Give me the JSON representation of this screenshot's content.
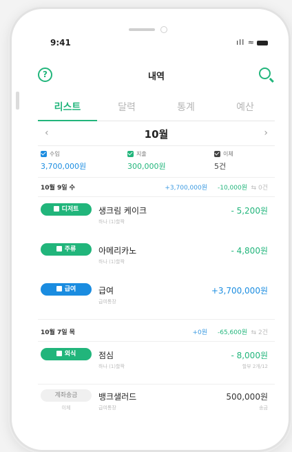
{
  "status": {
    "time": "9:41",
    "icons": "ıll ≈"
  },
  "header": {
    "title": "내역"
  },
  "tabs": [
    {
      "label": "리스트",
      "active": true
    },
    {
      "label": "달력"
    },
    {
      "label": "통계"
    },
    {
      "label": "예산"
    }
  ],
  "month": {
    "label": "10월",
    "prev": "‹",
    "next": "›"
  },
  "summary": {
    "income": {
      "label": "수입",
      "value": "3,700,000원",
      "color": "#1a8ce0"
    },
    "expense": {
      "label": "지출",
      "value": "300,000원",
      "color": "#21b57b"
    },
    "transfer": {
      "label": "이체",
      "value": "5건",
      "color": "#444444"
    }
  },
  "groups": [
    {
      "date": "10월 9일 수",
      "income": "+3,700,000원",
      "expense": "-10,000원",
      "count": "⇆ 0건",
      "items": [
        {
          "category": "디저트",
          "name": "생크림 케이크",
          "sub": "하나 (1)할짝",
          "amount": "- 5,200원",
          "color": "green"
        },
        {
          "category": "주류",
          "name": "아메리카노",
          "sub": "하나 (1)할짝",
          "amount": "- 4,800원",
          "color": "green"
        },
        {
          "category": "급여",
          "name": "급여",
          "sub": "급여통장",
          "amount": "+3,700,000원",
          "color": "blue"
        }
      ]
    },
    {
      "date": "10월 7일 목",
      "income": "+0원",
      "expense": "-65,600원",
      "count": "⇆ 2건",
      "items": [
        {
          "category": "외식",
          "name": "점심",
          "sub": "하나 (1)할짝",
          "amount": "- 8,000원",
          "asub": "할부 2개/12",
          "color": "green"
        },
        {
          "category": "계좌송금",
          "name": "뱅크샐러드",
          "sub": "급여통장",
          "psub": "이체",
          "amount": "500,000원",
          "asub": "송금",
          "color": "gray"
        }
      ]
    }
  ]
}
